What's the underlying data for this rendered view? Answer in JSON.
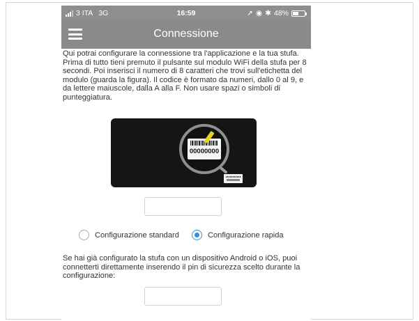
{
  "status_bar": {
    "carrier": "3 ITA",
    "network": "3G",
    "time": "16:59",
    "battery": "48%",
    "battery_level": 0.48
  },
  "navbar": {
    "title": "Connessione",
    "menu_icon": "hamburger-menu-icon"
  },
  "intro_text": "Qui potrai configurare la connessione tra l'applicazione e la tua stufa. Prima di tutto tieni premuto il pulsante sul modulo WiFi della stufa per 8 secondi. Poi inserisci il numero di 8 caratteri che trovi sull'etichetta del modulo (guarda la figura). Il codice è formato da numeri, dallo 0 al 9, e da lettere maiuscole, dalla A alla F. Non usare spazi o simboli di punteggiatura.",
  "figure": {
    "code_example": "00000000"
  },
  "code_input": {
    "value": "",
    "placeholder": ""
  },
  "config_options": [
    {
      "label": "Configurazione standard",
      "selected": false
    },
    {
      "label": "Configurazione rapida",
      "selected": true
    }
  ],
  "pin_note": "Se hai già configurato la stufa con un dispositivo Android o iOS, puoi connetterti direttamente inserendo il pin di sicurezza scelto durante la configurazione:",
  "pin_input": {
    "value": "",
    "placeholder": ""
  },
  "colors": {
    "navbar": "#8a8a8a",
    "radio_accent": "#2e8fe0",
    "text": "#333333",
    "figure_bg": "#151515"
  }
}
